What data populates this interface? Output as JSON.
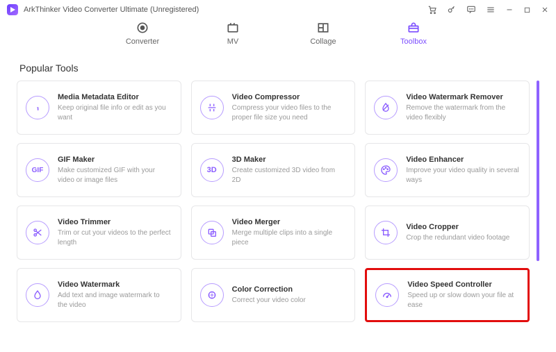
{
  "window": {
    "title": "ArkThinker Video Converter Ultimate (Unregistered)"
  },
  "nav": {
    "converter": "Converter",
    "mv": "MV",
    "collage": "Collage",
    "toolbox": "Toolbox"
  },
  "section_title": "Popular Tools",
  "tools": {
    "metadata": {
      "title": "Media Metadata Editor",
      "desc": "Keep original file info or edit as you want"
    },
    "compress": {
      "title": "Video Compressor",
      "desc": "Compress your video files to the proper file size you need"
    },
    "wm_remove": {
      "title": "Video Watermark Remover",
      "desc": "Remove the watermark from the video flexibly"
    },
    "gif": {
      "title": "GIF Maker",
      "desc": "Make customized GIF with your video or image files"
    },
    "threed": {
      "title": "3D Maker",
      "desc": "Create customized 3D video from 2D"
    },
    "enhance": {
      "title": "Video Enhancer",
      "desc": "Improve your video quality in several ways"
    },
    "trim": {
      "title": "Video Trimmer",
      "desc": "Trim or cut your videos to the perfect length"
    },
    "merge": {
      "title": "Video Merger",
      "desc": "Merge multiple clips into a single piece"
    },
    "crop": {
      "title": "Video Cropper",
      "desc": "Crop the redundant video footage"
    },
    "wm_add": {
      "title": "Video Watermark",
      "desc": "Add text and image watermark to the video"
    },
    "color": {
      "title": "Color Correction",
      "desc": "Correct your video color"
    },
    "speed": {
      "title": "Video Speed Controller",
      "desc": "Speed up or slow down your file at ease"
    }
  },
  "colors": {
    "accent": "#7b4cff",
    "highlight": "#e20d0d"
  }
}
